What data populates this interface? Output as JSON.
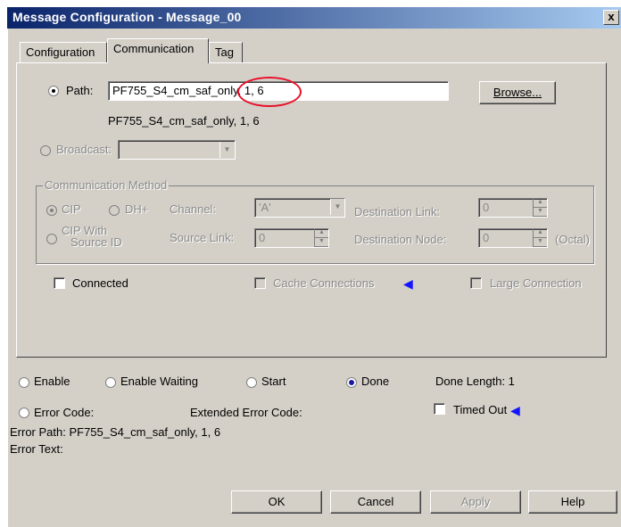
{
  "window": {
    "title": "Message Configuration - Message_00",
    "close_label": "x"
  },
  "tabs": [
    "Configuration",
    "Communication",
    "Tag"
  ],
  "path": {
    "label": "Path:",
    "value": "PF755_S4_cm_saf_only, 1, 6",
    "resolved": "PF755_S4_cm_saf_only, 1, 6",
    "browse_label": "Browse..."
  },
  "broadcast": {
    "label": "Broadcast:"
  },
  "comm_method": {
    "title": "Communication Method",
    "cip_label": "CIP",
    "dhplus_label": "DH+",
    "channel_label": "Channel:",
    "channel_value": "'A'",
    "dest_link_label": "Destination Link:",
    "dest_link_value": "0",
    "cip_source_label_1": "CIP With",
    "cip_source_label_2": "Source ID",
    "source_link_label": "Source Link:",
    "source_link_value": "0",
    "dest_node_label": "Destination Node:",
    "dest_node_value": "0",
    "octal_label": "(Octal)"
  },
  "options": {
    "connected_label": "Connected",
    "cache_label": "Cache Connections",
    "large_label": "Large Connection"
  },
  "status": {
    "enable": "Enable",
    "enable_waiting": "Enable Waiting",
    "start": "Start",
    "done": "Done",
    "done_length": "Done Length: 1",
    "error_code": "Error Code:",
    "extended_error_code": "Extended Error Code:",
    "timed_out": "Timed Out",
    "error_path": "Error Path: PF755_S4_cm_saf_only, 1, 6",
    "error_text": "Error Text:"
  },
  "buttons": {
    "ok": "OK",
    "cancel": "Cancel",
    "apply": "Apply",
    "help": "Help"
  },
  "colors": {
    "title_start": "#0a246a",
    "title_end": "#a6caf0",
    "annotation_red": "#e8102a",
    "arrow_blue": "#1414ff"
  }
}
